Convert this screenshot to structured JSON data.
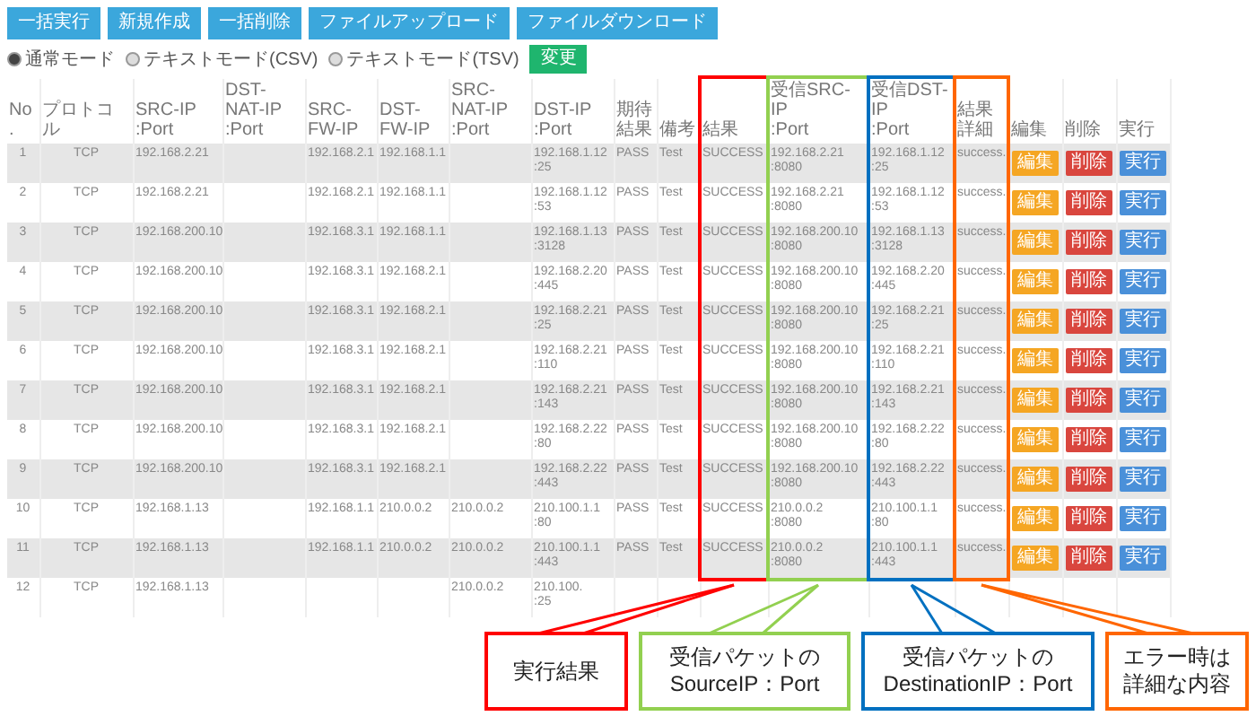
{
  "toolbar": {
    "buttons": [
      "一括実行",
      "新規作成",
      "一括削除",
      "ファイルアップロード",
      "ファイルダウンロード"
    ]
  },
  "mode": {
    "options": [
      {
        "label": "通常モード",
        "selected": true
      },
      {
        "label": "テキストモード(CSV)",
        "selected": false
      },
      {
        "label": "テキストモード(TSV)",
        "selected": false
      }
    ],
    "apply_button": "変更"
  },
  "table": {
    "columns": [
      "No.",
      "プロトコル",
      "SRC-IP\n:Port",
      "DST-NAT-IP\n:Port",
      "SRC-FW-IP",
      "DST-FW-IP",
      "SRC-NAT-IP\n:Port",
      "DST-IP\n:Port",
      "期待結果",
      "備考",
      "結果",
      "受信SRC-IP\n:Port",
      "受信DST-IP\n:Port",
      "結果詳細",
      "編集",
      "削除",
      "実行"
    ],
    "rows": [
      {
        "cells": [
          "1",
          "TCP",
          "192.168.2.21",
          null,
          "192.168.2.1",
          "192.168.1.1",
          null,
          "192.168.1.12\n:25",
          "PASS",
          "Test",
          "SUCCESS",
          "192.168.2.21\n:8080",
          "192.168.1.12\n:25",
          "success."
        ],
        "actions": [
          "編集",
          "削除",
          "実行"
        ]
      },
      {
        "cells": [
          "2",
          "TCP",
          "192.168.2.21",
          null,
          "192.168.2.1",
          "192.168.1.1",
          null,
          "192.168.1.12\n:53",
          "PASS",
          "Test",
          "SUCCESS",
          "192.168.2.21\n:8080",
          "192.168.1.12\n:53",
          "success."
        ],
        "actions": [
          "編集",
          "削除",
          "実行"
        ]
      },
      {
        "cells": [
          "3",
          "TCP",
          "192.168.200.10",
          null,
          "192.168.3.1",
          "192.168.1.1",
          null,
          "192.168.1.13\n:3128",
          "PASS",
          "Test",
          "SUCCESS",
          "192.168.200.10\n:8080",
          "192.168.1.13\n:3128",
          "success."
        ],
        "actions": [
          "編集",
          "削除",
          "実行"
        ]
      },
      {
        "cells": [
          "4",
          "TCP",
          "192.168.200.10",
          null,
          "192.168.3.1",
          "192.168.2.1",
          null,
          "192.168.2.20\n:445",
          "PASS",
          "Test",
          "SUCCESS",
          "192.168.200.10\n:8080",
          "192.168.2.20\n:445",
          "success."
        ],
        "actions": [
          "編集",
          "削除",
          "実行"
        ]
      },
      {
        "cells": [
          "5",
          "TCP",
          "192.168.200.10",
          null,
          "192.168.3.1",
          "192.168.2.1",
          null,
          "192.168.2.21\n:25",
          "PASS",
          "Test",
          "SUCCESS",
          "192.168.200.10\n:8080",
          "192.168.2.21\n:25",
          "success."
        ],
        "actions": [
          "編集",
          "削除",
          "実行"
        ]
      },
      {
        "cells": [
          "6",
          "TCP",
          "192.168.200.10",
          null,
          "192.168.3.1",
          "192.168.2.1",
          null,
          "192.168.2.21\n:110",
          "PASS",
          "Test",
          "SUCCESS",
          "192.168.200.10\n:8080",
          "192.168.2.21\n:110",
          "success."
        ],
        "actions": [
          "編集",
          "削除",
          "実行"
        ]
      },
      {
        "cells": [
          "7",
          "TCP",
          "192.168.200.10",
          null,
          "192.168.3.1",
          "192.168.2.1",
          null,
          "192.168.2.21\n:143",
          "PASS",
          "Test",
          "SUCCESS",
          "192.168.200.10\n:8080",
          "192.168.2.21\n:143",
          "success."
        ],
        "actions": [
          "編集",
          "削除",
          "実行"
        ]
      },
      {
        "cells": [
          "8",
          "TCP",
          "192.168.200.10",
          null,
          "192.168.3.1",
          "192.168.2.1",
          null,
          "192.168.2.22\n:80",
          "PASS",
          "Test",
          "SUCCESS",
          "192.168.200.10\n:8080",
          "192.168.2.22\n:80",
          "success."
        ],
        "actions": [
          "編集",
          "削除",
          "実行"
        ]
      },
      {
        "cells": [
          "9",
          "TCP",
          "192.168.200.10",
          null,
          "192.168.3.1",
          "192.168.2.1",
          null,
          "192.168.2.22\n:443",
          "PASS",
          "Test",
          "SUCCESS",
          "192.168.200.10\n:8080",
          "192.168.2.22\n:443",
          "success."
        ],
        "actions": [
          "編集",
          "削除",
          "実行"
        ]
      },
      {
        "cells": [
          "10",
          "TCP",
          "192.168.1.13",
          null,
          "192.168.1.1",
          "210.0.0.2",
          "210.0.0.2",
          "210.100.1.1\n:80",
          "PASS",
          "Test",
          "SUCCESS",
          "210.0.0.2\n:8080",
          "210.100.1.1\n:80",
          "success."
        ],
        "actions": [
          "編集",
          "削除",
          "実行"
        ]
      },
      {
        "cells": [
          "11",
          "TCP",
          "192.168.1.13",
          null,
          "192.168.1.1",
          "210.0.0.2",
          "210.0.0.2",
          "210.100.1.1\n:443",
          "PASS",
          "Test",
          "SUCCESS",
          "210.0.0.2\n:8080",
          "210.100.1.1\n:443",
          "success."
        ],
        "actions": [
          "編集",
          "削除",
          "実行"
        ]
      },
      {
        "cells": [
          "12",
          "TCP",
          "192.168.1.13",
          null,
          null,
          null,
          "210.0.0.2",
          "210.100.\n:25",
          null,
          null,
          null,
          null,
          null,
          null
        ]
      }
    ]
  },
  "callouts": [
    {
      "lines": [
        "実行結果"
      ],
      "color": "#ff0000"
    },
    {
      "lines": [
        "受信パケットの",
        "SourceIP：Port"
      ],
      "color": "#92d050"
    },
    {
      "lines": [
        "受信パケットの",
        "DestinationIP：Port"
      ],
      "color": "#0070c0"
    },
    {
      "lines": [
        "エラー時は",
        "詳細な内容"
      ],
      "color": "#ff6600"
    }
  ]
}
